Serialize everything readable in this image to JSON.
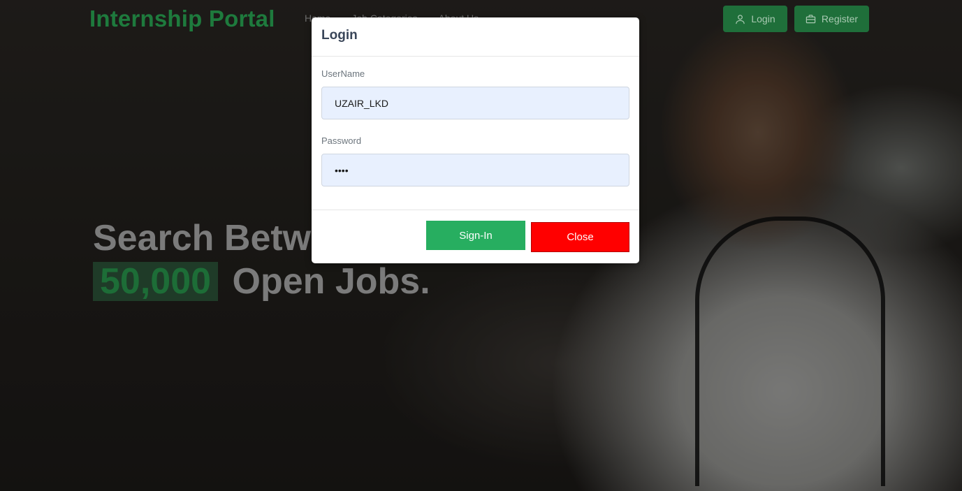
{
  "navbar": {
    "brand": "Internship Portal",
    "links": [
      "Home",
      "Job Categories",
      "About Us"
    ],
    "login_label": "Login",
    "register_label": "Register"
  },
  "hero": {
    "line1": "Search Between",
    "highlight": "50,000",
    "line2_rest": "Open Jobs."
  },
  "modal": {
    "title": "Login",
    "username_label": "UserName",
    "username_value": "UZAIR_LKD",
    "password_label": "Password",
    "password_value": "abcd",
    "signin_label": "Sign-In",
    "close_label": "Close"
  },
  "colors": {
    "brand_green": "#1e7a3d",
    "signin_green": "#27ae60",
    "close_red": "#ff0000",
    "input_bg": "#e8f0fe"
  },
  "icons": {
    "login": "user-icon",
    "register": "briefcase-icon"
  }
}
